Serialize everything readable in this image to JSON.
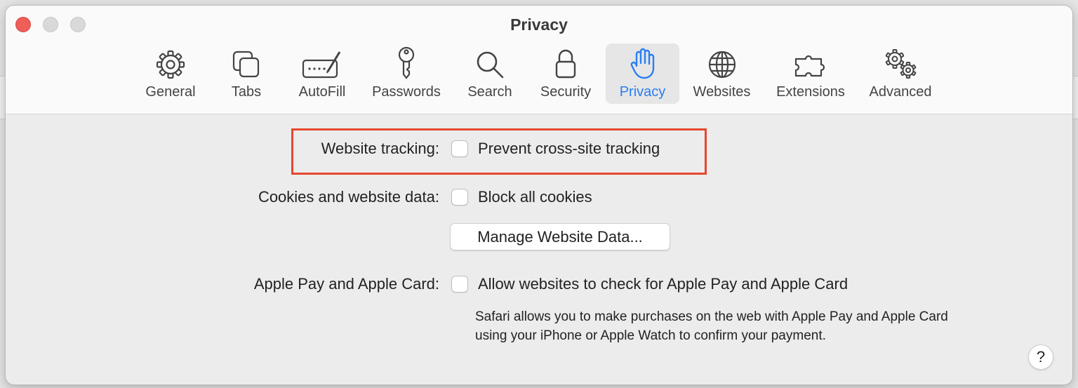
{
  "window": {
    "title": "Privacy"
  },
  "tabs": [
    {
      "label": "General",
      "icon": "gear-icon"
    },
    {
      "label": "Tabs",
      "icon": "tabs-icon"
    },
    {
      "label": "AutoFill",
      "icon": "autofill-icon"
    },
    {
      "label": "Passwords",
      "icon": "key-icon"
    },
    {
      "label": "Search",
      "icon": "search-icon"
    },
    {
      "label": "Security",
      "icon": "lock-icon"
    },
    {
      "label": "Privacy",
      "icon": "hand-icon",
      "active": true
    },
    {
      "label": "Websites",
      "icon": "globe-icon"
    },
    {
      "label": "Extensions",
      "icon": "puzzle-icon"
    },
    {
      "label": "Advanced",
      "icon": "gears-icon"
    }
  ],
  "settings": {
    "tracking": {
      "label": "Website tracking:",
      "option": "Prevent cross-site tracking",
      "checked": false
    },
    "cookies": {
      "label": "Cookies and website data:",
      "option": "Block all cookies",
      "checked": false,
      "button": "Manage Website Data..."
    },
    "applepay": {
      "label": "Apple Pay and Apple Card:",
      "option": "Allow websites to check for Apple Pay and Apple Card",
      "checked": false,
      "description": "Safari allows you to make purchases on the web with Apple Pay and Apple Card using your iPhone or Apple Watch to confirm your payment."
    }
  },
  "help": {
    "label": "?"
  },
  "colors": {
    "accent": "#2a7ef1",
    "highlight": "#e5472f",
    "close": "#ee5f58"
  }
}
